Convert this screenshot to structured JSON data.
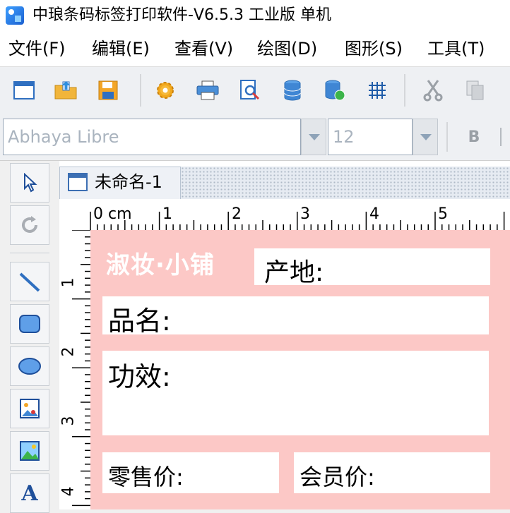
{
  "window": {
    "title": "中琅条码标签打印软件-V6.5.3 工业版 单机"
  },
  "menu": {
    "items": [
      {
        "label": "文件(F)"
      },
      {
        "label": "编辑(E)"
      },
      {
        "label": "查看(V)"
      },
      {
        "label": "绘图(D)"
      },
      {
        "label": "图形(S)"
      },
      {
        "label": "工具(T)"
      }
    ]
  },
  "toolbar": {
    "icons": [
      "new-document-icon",
      "open-folder-icon",
      "save-icon",
      "settings-gear-icon",
      "print-icon",
      "print-preview-icon",
      "database-icon",
      "database-connect-icon",
      "grid-icon",
      "cut-icon",
      "copy-icon"
    ]
  },
  "fontbar": {
    "font_name": "Abhaya Libre",
    "font_size": "12",
    "bold_label": "B"
  },
  "toolbox": {
    "tools": [
      "select-arrow-icon",
      "rotate-icon",
      "line-tool-icon",
      "rounded-rect-tool-icon",
      "ellipse-tool-icon",
      "image-tool-icon",
      "picture-tool-icon",
      "text-tool-icon"
    ],
    "text_tool_glyph": "A"
  },
  "document": {
    "tab_label": "未命名-1",
    "ruler_h_labels": [
      "0 cm",
      "1",
      "2",
      "3",
      "4",
      "5"
    ],
    "ruler_v_labels": [
      "1",
      "2",
      "3",
      "4"
    ]
  },
  "label": {
    "brand": "淑妆·小铺",
    "origin_label": "产地:",
    "name_label": "品名:",
    "effect_label": "功效:",
    "retail_price_label": "零售价:",
    "member_price_label": "会员价:",
    "colors": {
      "background": "#fcc8c6",
      "field": "#ffffff",
      "brand_text": "#ffffff"
    }
  }
}
